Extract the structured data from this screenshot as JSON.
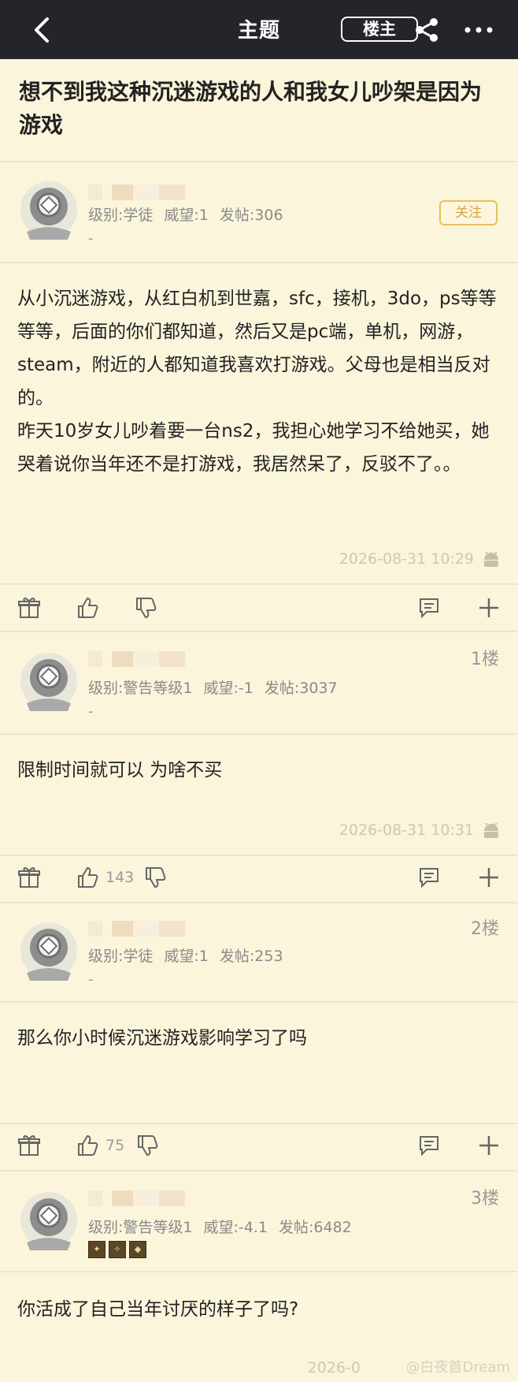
{
  "topbar": {
    "title": "主题",
    "owner_button": "楼主"
  },
  "thread": {
    "title": "想不到我这种沉迷游戏的人和我女儿吵架是因为游戏"
  },
  "posts": [
    {
      "meta": {
        "level": "级别:学徒",
        "prestige": "威望:1",
        "posts": "发帖:306"
      },
      "dash": "-",
      "follow_label": "关注",
      "content": "从小沉迷游戏，从红白机到世嘉，sfc，接机，3do，ps等等等等，后面的你们都知道，然后又是pc端，单机，网游，steam，附近的人都知道我喜欢打游戏。父母也是相当反对的。\n昨天10岁女儿吵着要一台ns2，我担心她学习不给她买，她哭着说你当年还不是打游戏，我居然呆了，反驳不了。。",
      "timestamp": "2026-08-31 10:29"
    },
    {
      "floor": "1楼",
      "meta": {
        "level": "级别:警告等级1",
        "prestige": "威望:-1",
        "posts": "发帖:3037"
      },
      "dash": "-",
      "content": "限制时间就可以 为啥不买",
      "timestamp": "2026-08-31 10:31",
      "likes": "143"
    },
    {
      "floor": "2楼",
      "meta": {
        "level": "级别:学徒",
        "prestige": "威望:1",
        "posts": "发帖:253"
      },
      "dash": "-",
      "content": "那么你小时候沉迷游戏影响学习了吗",
      "likes": "75"
    },
    {
      "floor": "3楼",
      "meta": {
        "level": "级别:警告等级1",
        "prestige": "威望:-4.1",
        "posts": "发帖:6482"
      },
      "content": "你活成了自己当年讨厌的样子了吗?",
      "timestamp": "2026-0"
    }
  ],
  "watermark": "@白夜首Dream",
  "icons": [
    "back-icon",
    "share-icon",
    "more-icon",
    "gift-icon",
    "like-icon",
    "dislike-icon",
    "comment-icon",
    "plus-icon",
    "android-icon",
    "avatar-diver-helmet-icon"
  ],
  "colors": {
    "topbar": "#23252b",
    "background": "#fbf5dc",
    "follow": "#e6c15d"
  }
}
